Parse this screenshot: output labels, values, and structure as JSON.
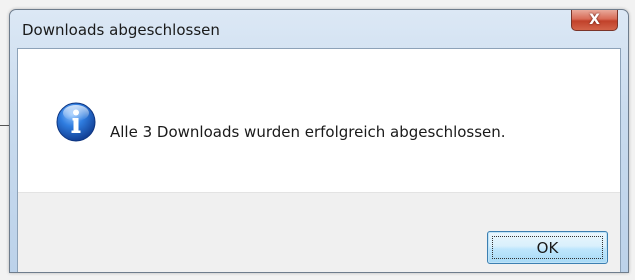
{
  "dialog": {
    "title": "Downloads abgeschlossen",
    "message": "Alle 3 Downloads wurden erfolgreich abgeschlossen.",
    "ok_label": "OK",
    "close_glyph": "X",
    "icon": "info-icon"
  },
  "colors": {
    "close_button": "#c1412a",
    "ok_button_border": "#3c7fb1",
    "info_icon": "#1f5fc4"
  }
}
